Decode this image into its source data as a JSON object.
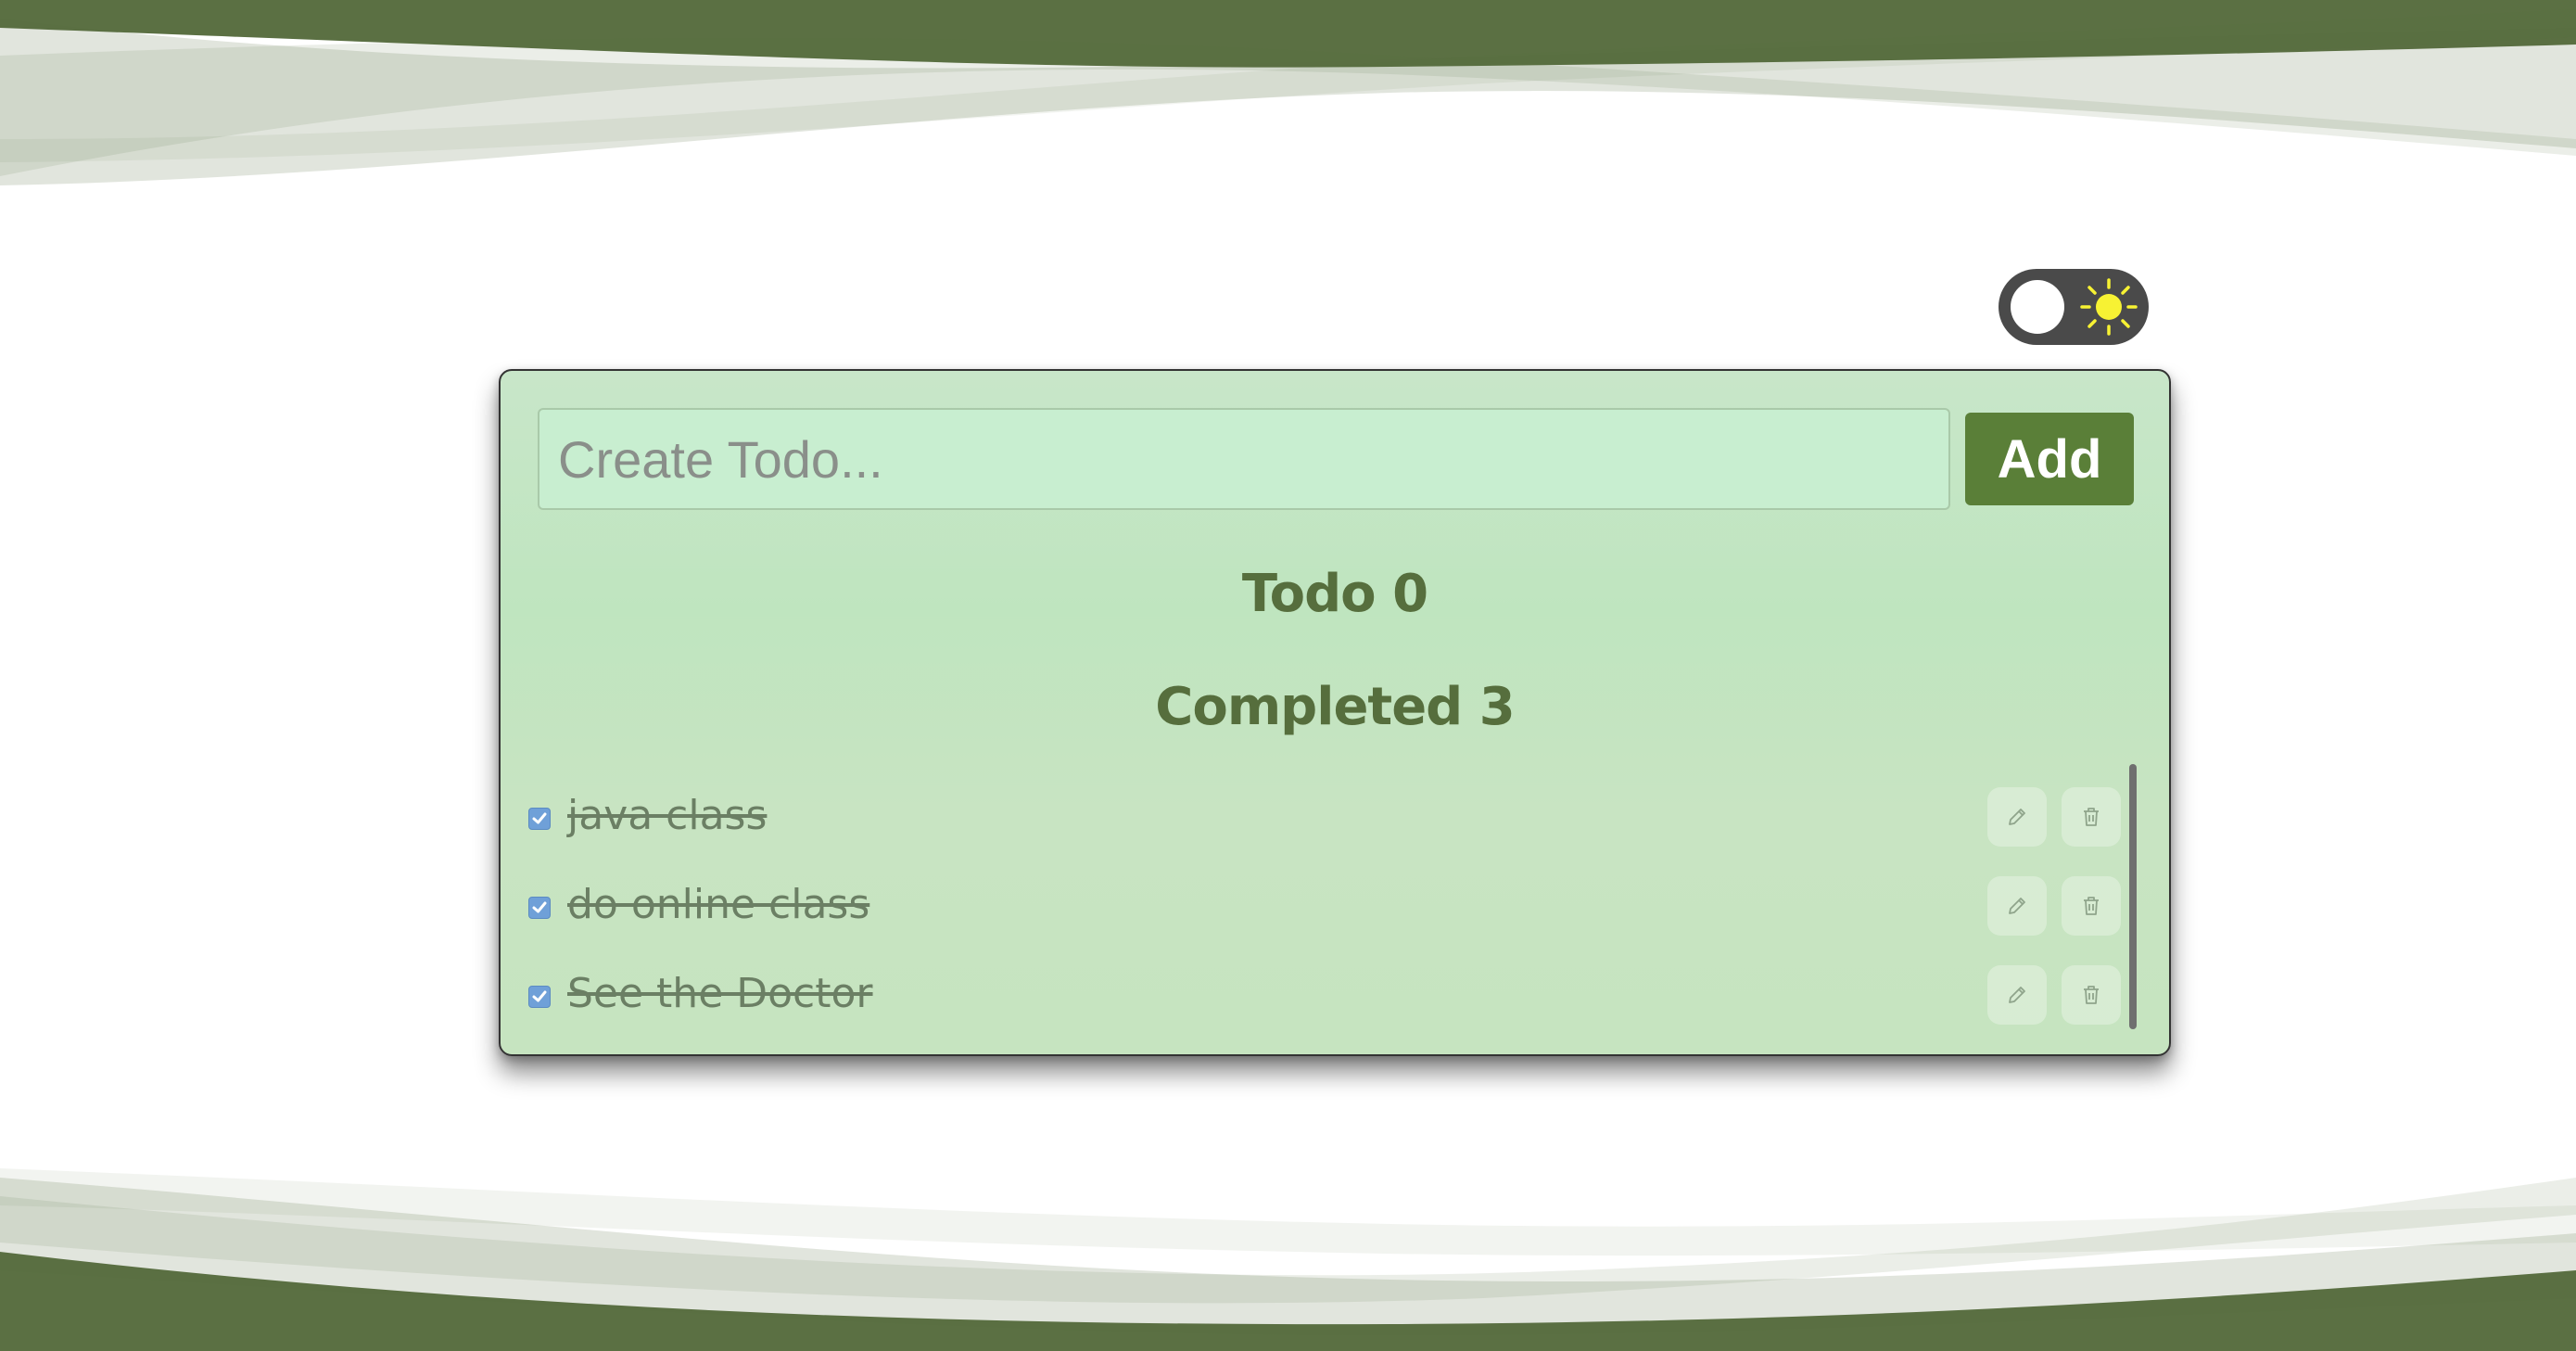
{
  "theme_toggle": {
    "mode": "light",
    "icon": "sun-icon",
    "sun_color": "#f7f233",
    "track_color": "#4a4a4a"
  },
  "colors": {
    "brand_green": "#5a7f38",
    "wave_dark": "#5b7043",
    "card_background": "#c6e6c3",
    "heading_color": "#566e3d"
  },
  "todo_form": {
    "placeholder": "Create Todo...",
    "value": "",
    "add_label": "Add"
  },
  "counters": {
    "todo_label": "Todo 0",
    "completed_label": "Completed 3"
  },
  "completed_items": [
    {
      "text": "java class",
      "checked": true,
      "edit_icon": "pencil-icon",
      "delete_icon": "trash-icon"
    },
    {
      "text": "do online class",
      "checked": true,
      "edit_icon": "pencil-icon",
      "delete_icon": "trash-icon"
    },
    {
      "text": "See the Doctor",
      "checked": true,
      "edit_icon": "pencil-icon",
      "delete_icon": "trash-icon"
    }
  ]
}
